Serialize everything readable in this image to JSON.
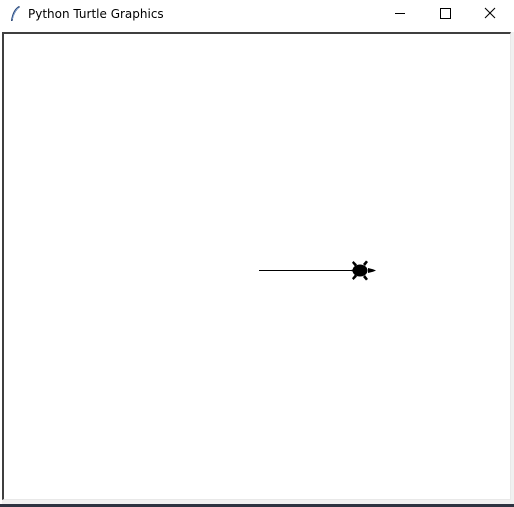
{
  "window": {
    "title": "Python Turtle Graphics"
  },
  "controls": {
    "minimize_icon": "minimize-icon",
    "maximize_icon": "maximize-icon",
    "close_icon": "close-icon"
  },
  "canvas": {
    "background": "#ffffff",
    "pen_color": "#000000",
    "turtle_shape": "turtle",
    "turtle_heading": "east"
  }
}
